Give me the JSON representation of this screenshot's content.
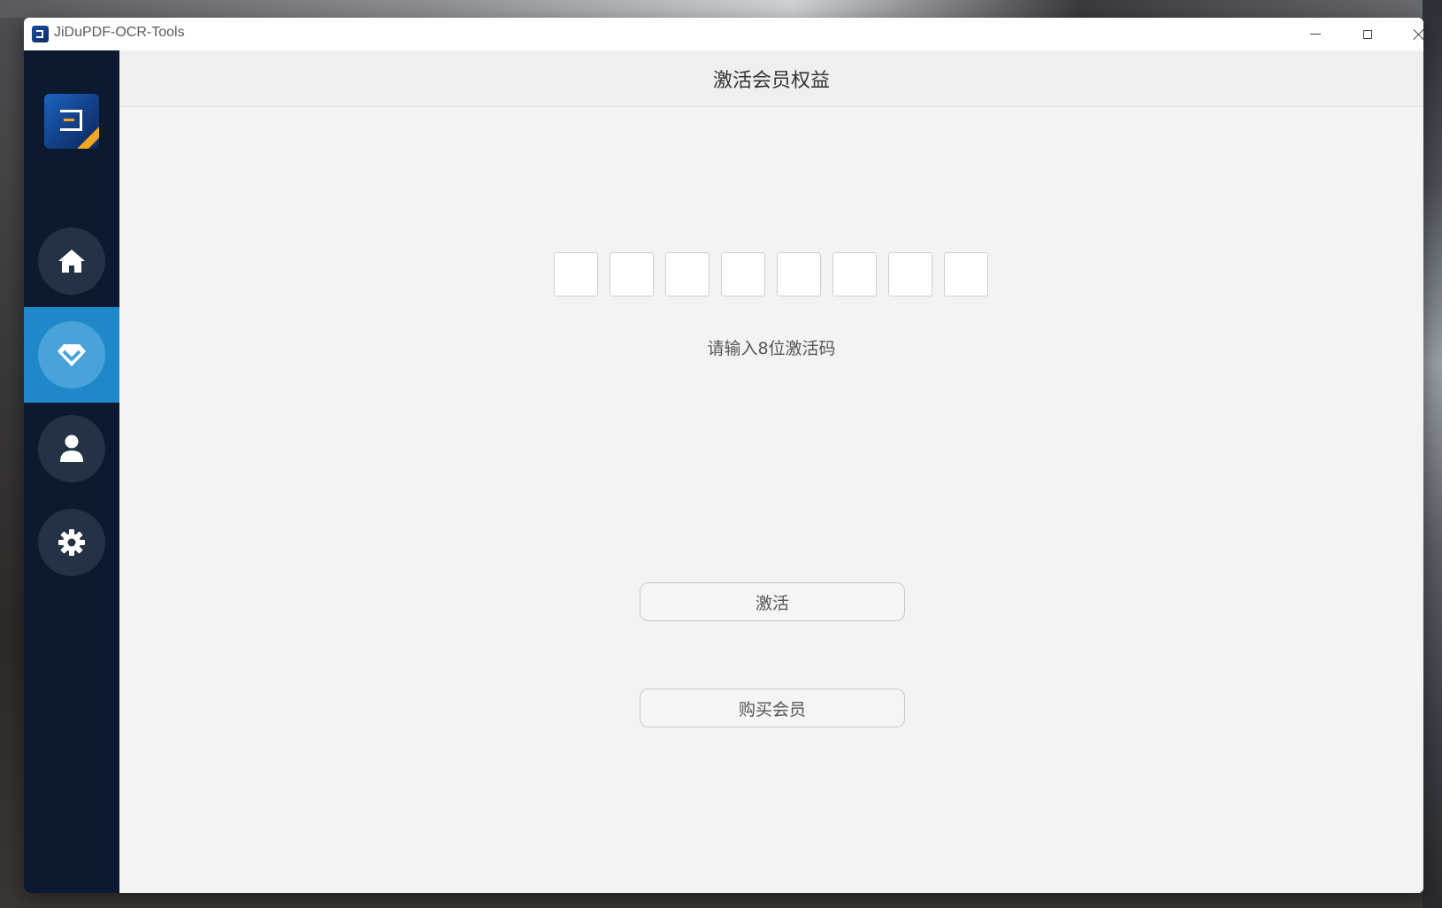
{
  "window": {
    "title": "JiDuPDF-OCR-Tools"
  },
  "sidebar": {
    "items": [
      {
        "id": "home",
        "icon": "home-icon",
        "active": false
      },
      {
        "id": "membership",
        "icon": "diamond-icon",
        "active": true
      },
      {
        "id": "user",
        "icon": "user-icon",
        "active": false
      },
      {
        "id": "settings",
        "icon": "gear-icon",
        "active": false
      }
    ]
  },
  "main": {
    "title": "激活会员权益",
    "code_boxes": [
      "",
      "",
      "",
      "",
      "",
      "",
      "",
      ""
    ],
    "hint": "请输入8位激活码",
    "activate_label": "激活",
    "buy_label": "购买会员"
  },
  "colors": {
    "sidebar_bg": "#0b1a2e",
    "active_item_bg": "#1e88c8",
    "content_bg": "#f3f3f3"
  }
}
